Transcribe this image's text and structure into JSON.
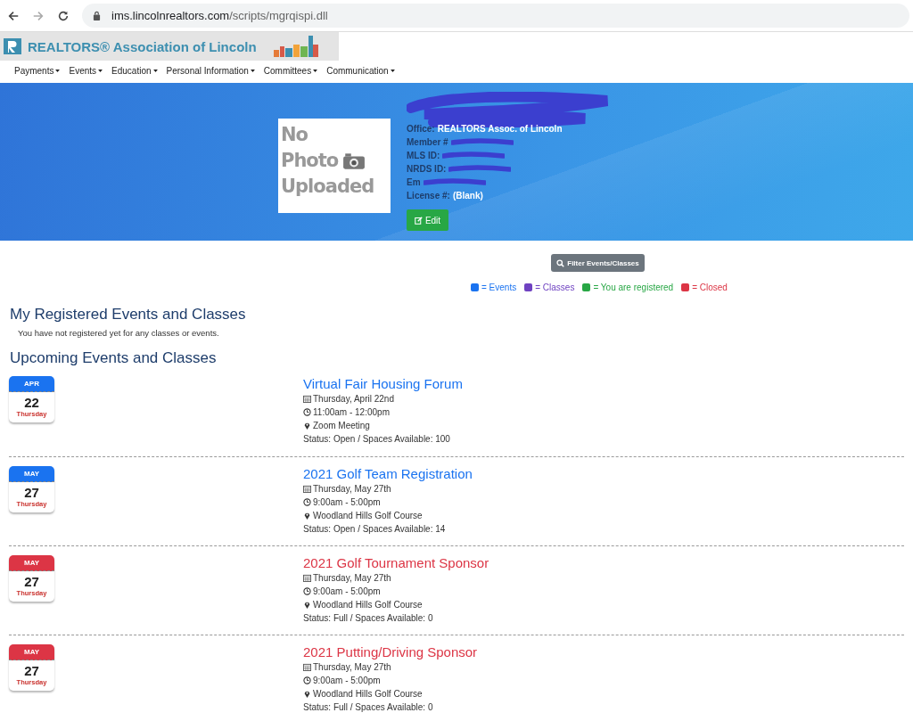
{
  "browser": {
    "url_host": "ims.lincolnrealtors.com",
    "url_path": "/scripts/mgrqispi.dll"
  },
  "logo": {
    "title": "REALTORS® Association of Lincoln"
  },
  "nav": [
    "Payments",
    "Events",
    "Education",
    "Personal Information",
    "Committees",
    "Communication"
  ],
  "profile": {
    "photo_lines": [
      "No",
      "Photo",
      "Uploaded"
    ],
    "fields": [
      {
        "label": "Office:",
        "value": "REALTORS Assoc. of Lincoln",
        "redacted": false
      },
      {
        "label": "Member #",
        "redacted": true
      },
      {
        "label": "MLS ID:",
        "redacted": true
      },
      {
        "label": "NRDS ID:",
        "redacted": true
      },
      {
        "label": "Em",
        "redacted": true
      },
      {
        "label": "License #:",
        "value": "(Blank)",
        "redacted": false
      }
    ],
    "edit_button": "Edit"
  },
  "filter_button": "Filter Events/Classes",
  "legend": [
    {
      "label": "= Events",
      "color": "#1a73f0"
    },
    {
      "label": "= Classes",
      "color": "#6f42c1"
    },
    {
      "label": "= You are registered",
      "color": "#28a745"
    },
    {
      "label": "= Closed",
      "color": "#dc3545"
    }
  ],
  "registered": {
    "heading": "My Registered Events and Classes",
    "message": "You have not registered yet for any classes or events."
  },
  "upcoming": {
    "heading": "Upcoming Events and Classes",
    "events": [
      {
        "month": "APR",
        "day": "22",
        "weekday": "Thursday",
        "title": "Virtual Fair Housing Forum",
        "date": "Thursday, April 22nd",
        "time": "11:00am - 12:00pm",
        "location": "Zoom Meeting",
        "status": "Status: Open / Spaces Available: 100",
        "color": "#1a73f0"
      },
      {
        "month": "MAY",
        "day": "27",
        "weekday": "Thursday",
        "title": "2021 Golf Team Registration",
        "date": "Thursday, May 27th",
        "time": "9:00am - 5:00pm",
        "location": "Woodland Hills Golf Course",
        "status": "Status: Open / Spaces Available: 14",
        "color": "#1a73f0"
      },
      {
        "month": "MAY",
        "day": "27",
        "weekday": "Thursday",
        "title": "2021 Golf Tournament Sponsor",
        "date": "Thursday, May 27th",
        "time": "9:00am - 5:00pm",
        "location": "Woodland Hills Golf Course",
        "status": "Status: Full / Spaces Available: 0",
        "color": "#dc3545"
      },
      {
        "month": "MAY",
        "day": "27",
        "weekday": "Thursday",
        "title": "2021 Putting/Driving Sponsor",
        "date": "Thursday, May 27th",
        "time": "9:00am - 5:00pm",
        "location": "Woodland Hills Golf Course",
        "status": "Status: Full / Spaces Available: 0",
        "color": "#dc3545"
      }
    ]
  }
}
